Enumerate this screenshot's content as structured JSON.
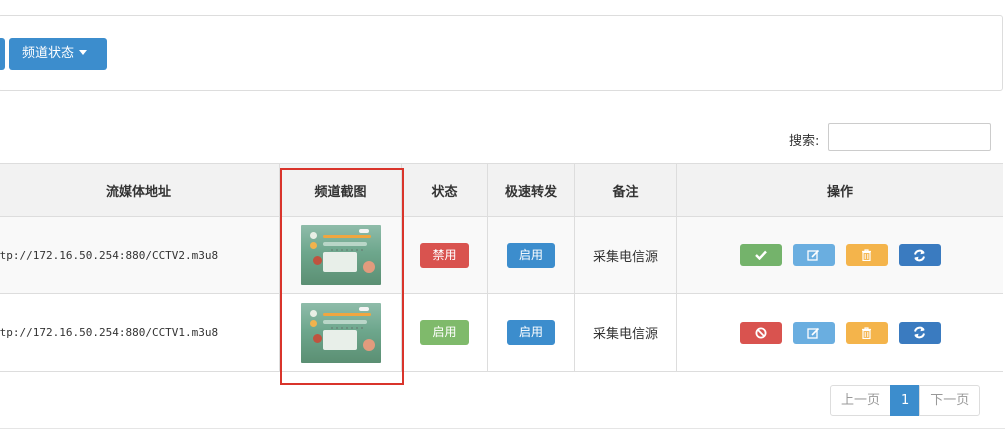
{
  "toolbar": {
    "channel_status_label": "频道状态"
  },
  "search": {
    "label": "搜索:",
    "value": "",
    "placeholder": ""
  },
  "table": {
    "headers": {
      "url": "流媒体地址",
      "screenshot": "频道截图",
      "status": "状态",
      "fast_forward": "极速转发",
      "note": "备注",
      "actions": "操作"
    },
    "rows": [
      {
        "url": "ttp://172.16.50.254:880/CCTV2.m3u8",
        "status_button": "禁用",
        "status_color": "#d9534f",
        "fast_forward_button": "启用",
        "note": "采集电信源",
        "actions": [
          "check-icon",
          "edit-icon",
          "trash-icon",
          "refresh-icon"
        ]
      },
      {
        "url": "ttp://172.16.50.254:880/CCTV1.m3u8",
        "status_button": "启用",
        "status_color": "#7fba6b",
        "fast_forward_button": "启用",
        "note": "采集电信源",
        "actions": [
          "ban-icon",
          "edit-icon",
          "trash-icon",
          "refresh-icon"
        ]
      }
    ]
  },
  "pagination": {
    "prev": "上一页",
    "current": "1",
    "next": "下一页"
  },
  "colors": {
    "primary": "#3c8dcd",
    "danger": "#d9534f",
    "success": "#7fba6b",
    "warning": "#f4b44b",
    "highlight": "#d9342b"
  }
}
